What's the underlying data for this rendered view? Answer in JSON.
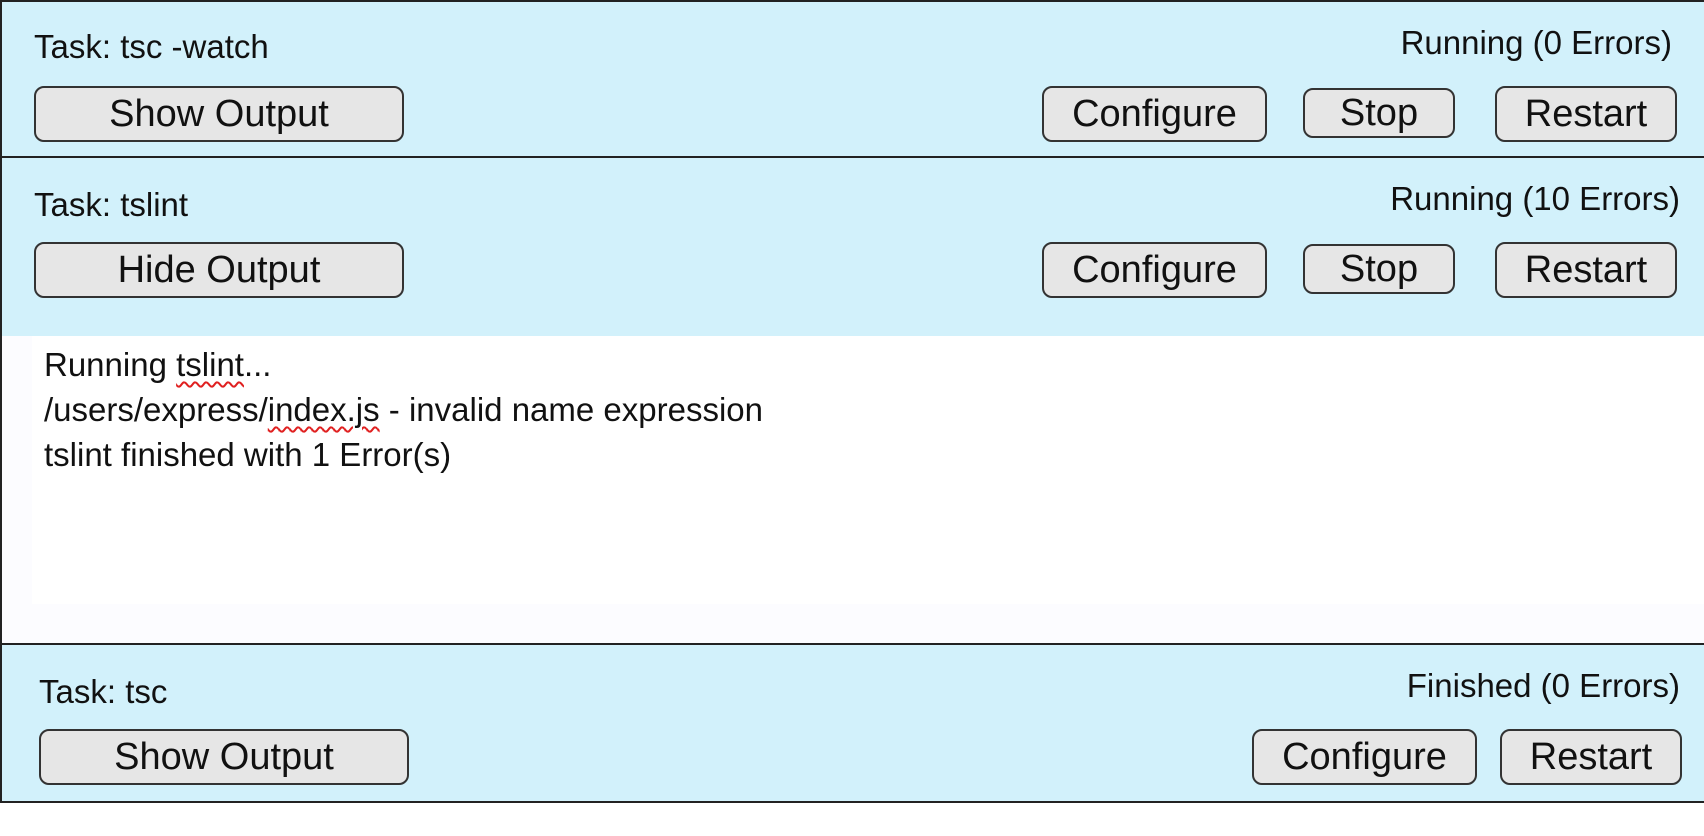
{
  "tasks": [
    {
      "title": "Task: tsc -watch",
      "status": "Running (0 Errors)",
      "output_toggle_label": "Show Output",
      "configure_label": "Configure",
      "stop_label": "Stop",
      "restart_label": "Restart"
    },
    {
      "title": "Task: tslint",
      "status": "Running (10 Errors)",
      "output_toggle_label": "Hide Output",
      "configure_label": "Configure",
      "stop_label": "Stop",
      "restart_label": "Restart",
      "output": {
        "line1_prefix": "Running ",
        "line1_word": "tslint",
        "line1_suffix": "...",
        "line2_prefix": "/users/express/",
        "line2_word": "index.js",
        "line2_suffix": " - invalid name expression",
        "line3": "tslint finished with 1 Error(s)"
      }
    },
    {
      "title": "Task: tsc",
      "status": "Finished (0 Errors)",
      "output_toggle_label": "Show Output",
      "configure_label": "Configure",
      "restart_label": "Restart"
    }
  ],
  "colors": {
    "panel_background": "#d2f1fb",
    "button_background": "#e6e6e6",
    "spellcheck_underline": "#e02020"
  }
}
